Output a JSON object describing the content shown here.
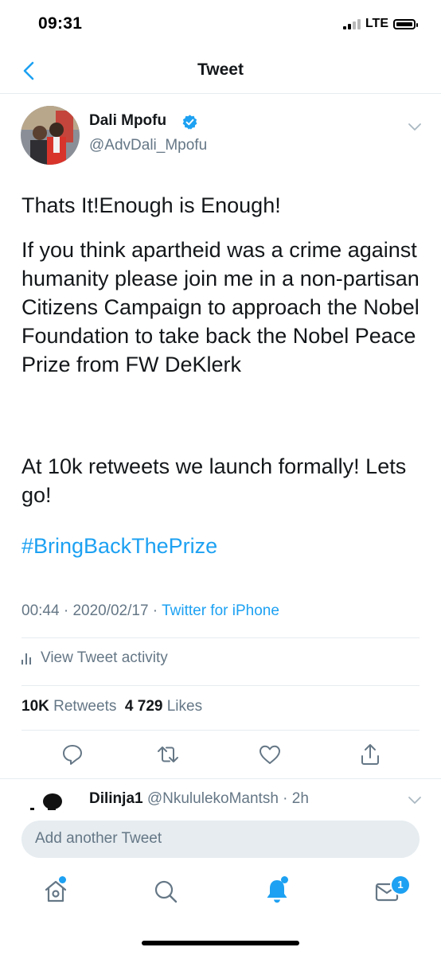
{
  "status_bar": {
    "time": "09:31",
    "network": "LTE"
  },
  "nav": {
    "title": "Tweet"
  },
  "tweet": {
    "author_name": "Dali Mpofu",
    "author_handle": "@AdvDali_Mpofu",
    "paragraphs": [
      "Thats It!Enough is Enough!",
      "If you think apartheid was a crime against humanity please join me in a non-partisan Citizens Campaign to approach the Nobel Foundation to take back the Nobel Peace Prize from FW DeKlerk",
      "At 10k retweets we launch formally! Lets go!"
    ],
    "hashtag": "#BringBackThePrize",
    "time": "00:44",
    "date": "2020/02/17",
    "source": "Twitter for iPhone",
    "separator": " · ",
    "activity_label": "View Tweet activity",
    "retweet_count": "10K",
    "retweet_label": "Retweets",
    "like_count": "4 729",
    "like_label": "Likes"
  },
  "reply_preview": {
    "name": "Dilinja1",
    "handle": "@NkululekoMantsh",
    "age": "2h",
    "separator": " · "
  },
  "compose": {
    "placeholder": "Add another Tweet"
  },
  "tab_bar": {
    "messages_badge": "1"
  },
  "colors": {
    "accent": "#1da1f2",
    "secondary_text": "#657786",
    "divider": "#e6ecf0"
  },
  "icons": [
    "back-chevron-icon",
    "verified-badge-icon",
    "chevron-down-icon",
    "reply-icon",
    "retweet-icon",
    "like-heart-icon",
    "share-icon",
    "analytics-bars-icon",
    "home-icon",
    "search-icon",
    "notifications-bell-icon",
    "messages-envelope-icon"
  ]
}
